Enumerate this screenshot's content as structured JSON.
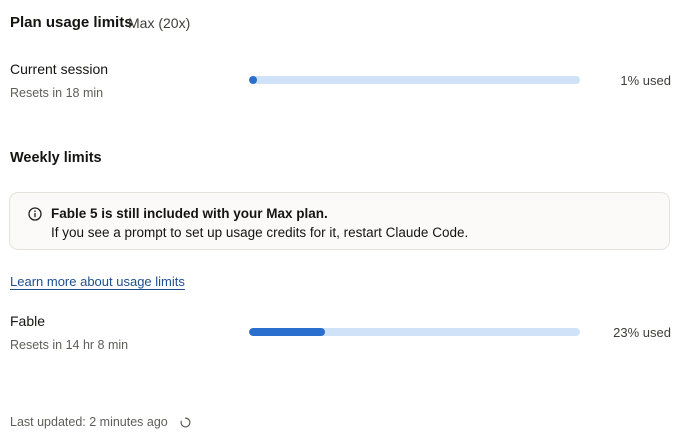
{
  "header": {
    "title": "Plan usage limits",
    "plan": "Max (20x)"
  },
  "current_session": {
    "label": "Current session",
    "resets": "Resets in 18 min",
    "used_text": "1% used",
    "percent": 1
  },
  "weekly": {
    "title": "Weekly limits",
    "notice": {
      "icon": "info-icon",
      "title": "Fable 5 is still included with your Max plan.",
      "body": "If you see a prompt to set up usage credits for it, restart Claude Code."
    },
    "learn_more": "Learn more about usage limits",
    "items": [
      {
        "label": "Fable",
        "resets": "Resets in 14 hr 8 min",
        "used_text": "23% used",
        "percent": 23
      }
    ]
  },
  "footer": {
    "last_updated": "Last updated: 2 minutes ago",
    "refresh_icon": "loading-spinner-icon"
  },
  "colors": {
    "bar_fill": "#2a6fce",
    "bar_track": "#cfe2f7",
    "link": "#1d4f8f"
  }
}
